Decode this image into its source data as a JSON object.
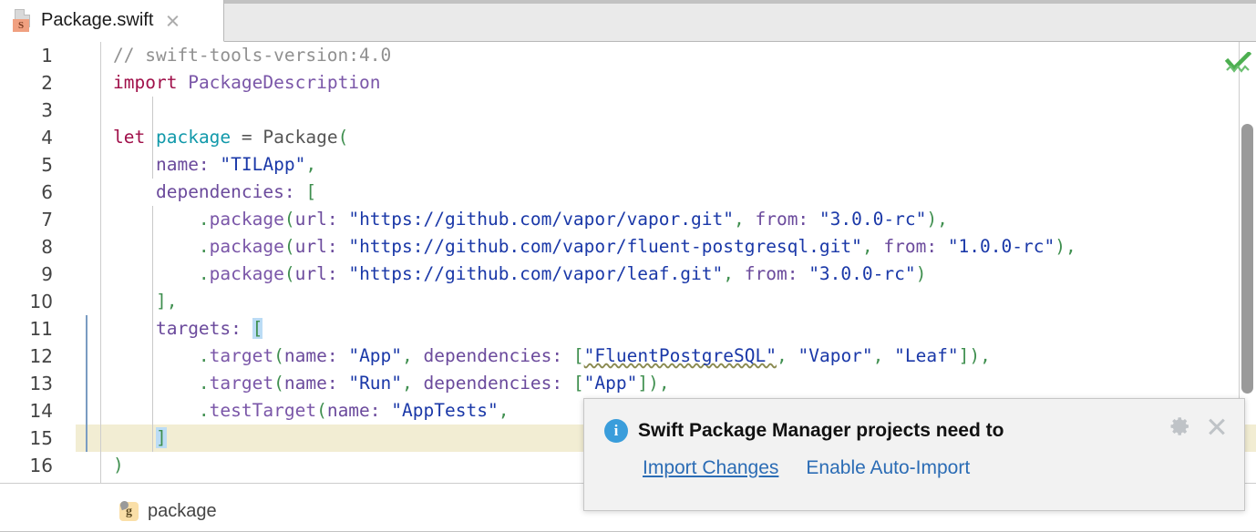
{
  "tab": {
    "title": "Package.swift",
    "icon": "swift-file-icon",
    "badge_letter": "S",
    "close_label": "×"
  },
  "editor": {
    "line_numbers": [
      "1",
      "2",
      "3",
      "4",
      "5",
      "6",
      "7",
      "8",
      "9",
      "10",
      "11",
      "12",
      "13",
      "14",
      "15",
      "16"
    ],
    "current_line": "15",
    "lines": [
      {
        "n": "1",
        "text": "// swift-tools-version:4.0"
      },
      {
        "n": "2",
        "text": "import PackageDescription"
      },
      {
        "n": "3",
        "text": ""
      },
      {
        "n": "4",
        "text": "let package = Package("
      },
      {
        "n": "5",
        "text": "    name: \"TILApp\","
      },
      {
        "n": "6",
        "text": "    dependencies: ["
      },
      {
        "n": "7",
        "text": "        .package(url: \"https://github.com/vapor/vapor.git\", from: \"3.0.0-rc\"),"
      },
      {
        "n": "8",
        "text": "        .package(url: \"https://github.com/vapor/fluent-postgresql.git\", from: \"1.0.0-rc\"),"
      },
      {
        "n": "9",
        "text": "        .package(url: \"https://github.com/vapor/leaf.git\", from: \"3.0.0-rc\")"
      },
      {
        "n": "10",
        "text": "    ],"
      },
      {
        "n": "11",
        "text": "    targets: ["
      },
      {
        "n": "12",
        "text": "        .target(name: \"App\", dependencies: [\"FluentPostgreSQL\", \"Vapor\", \"Leaf\"]),"
      },
      {
        "n": "13",
        "text": "        .target(name: \"Run\", dependencies: [\"App\"]),"
      },
      {
        "n": "14",
        "text": "        .testTarget(name: \"AppTests\","
      },
      {
        "n": "15",
        "text": "    ]"
      },
      {
        "n": "16",
        "text": ")"
      }
    ],
    "tokens": {
      "line1": {
        "comment": "// swift-tools-version:4.0"
      },
      "line2": {
        "kw": "import",
        "type": "PackageDescription"
      },
      "line4": {
        "kw": "let",
        "ident": "package",
        "eq": "=",
        "type": "Package",
        "paren": "("
      },
      "line5": {
        "label": "name:",
        "str": "\"TILApp\"",
        "comma": ","
      },
      "line6": {
        "label": "dependencies:",
        "brk": "["
      },
      "line7": {
        "dot": ".",
        "method": "package",
        "open": "(",
        "label": "url:",
        "str": "\"https://github.com/vapor/vapor.git\"",
        "comma1": ",",
        "label2": "from:",
        "str2": "\"3.0.0-rc\"",
        "close": ")",
        "comma2": ","
      },
      "line8": {
        "dot": ".",
        "method": "package",
        "open": "(",
        "label": "url:",
        "str": "\"https://github.com/vapor/fluent-postgresql.git\"",
        "comma1": ",",
        "label2": "from:",
        "str2": "\"1.0.0-rc\"",
        "close": ")",
        "comma2": ","
      },
      "line9": {
        "dot": ".",
        "method": "package",
        "open": "(",
        "label": "url:",
        "str": "\"https://github.com/vapor/leaf.git\"",
        "comma1": ",",
        "label2": "from:",
        "str2": "\"3.0.0-rc\"",
        "close": ")"
      },
      "line10": {
        "brk": "]",
        "comma": ","
      },
      "line11": {
        "label": "targets:",
        "brk": "["
      },
      "line12": {
        "dot": ".",
        "method": "target",
        "open": "(",
        "label": "name:",
        "str": "\"App\"",
        "comma1": ",",
        "label2": "dependencies:",
        "brk": "[",
        "str2": "\"FluentPostgreSQL\"",
        "comma2": ",",
        "str3": "\"Vapor\"",
        "comma3": ",",
        "str4": "\"Leaf\"",
        "brkc": "]",
        "close": ")",
        "comma4": ","
      },
      "line13": {
        "dot": ".",
        "method": "target",
        "open": "(",
        "label": "name:",
        "str": "\"Run\"",
        "comma1": ",",
        "label2": "dependencies:",
        "brk": "[",
        "str2": "\"App\"",
        "brkc": "]",
        "close": ")",
        "comma2": ","
      },
      "line14": {
        "dot": ".",
        "method": "testTarget",
        "open": "(",
        "label": "name:",
        "str": "\"AppTests\"",
        "comma1": ","
      },
      "line15": {
        "brk": "]"
      },
      "line16": {
        "close": ")"
      }
    },
    "inspection_status": "ok-checkmark",
    "scrollbar": {
      "name": "vertical-scrollbar"
    }
  },
  "breadcrumb": {
    "icon_letter": "g",
    "label": "package"
  },
  "notification": {
    "icon": "info-icon",
    "title": "Swift Package Manager projects need to",
    "primary_action": "Import Changes",
    "secondary_action": "Enable Auto-Import",
    "gear_label": "settings",
    "close_label": "close"
  },
  "colors": {
    "accent_link": "#2b6cb5",
    "info": "#3a9ddb",
    "highlight_line": "#f2edd3",
    "bracket_match": "#bbdcf5",
    "inspection_ok": "#4caf50",
    "keyword": "#a0104a",
    "string": "#1a38a8",
    "type": "#7a56a8",
    "comment": "#909090"
  }
}
